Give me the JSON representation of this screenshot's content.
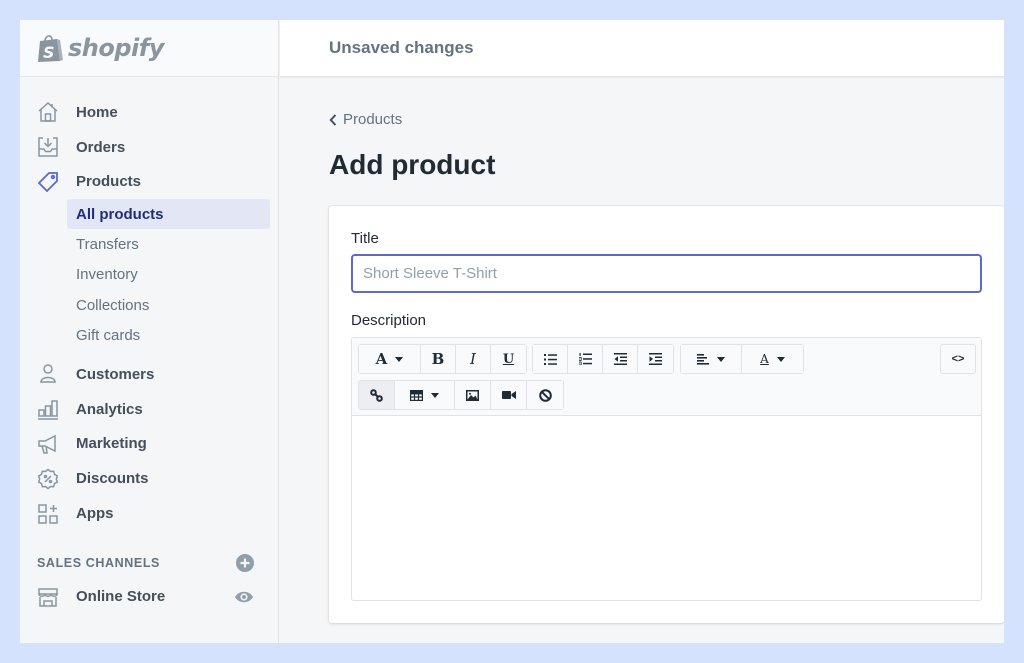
{
  "app": {
    "brand": "shopify"
  },
  "topbar": {
    "title": "Unsaved changes"
  },
  "sidebar": {
    "items": [
      {
        "label": "Home",
        "icon": "home-icon"
      },
      {
        "label": "Orders",
        "icon": "orders-icon"
      },
      {
        "label": "Products",
        "icon": "tag-icon",
        "active": true
      }
    ],
    "products_sub": [
      {
        "label": "All products",
        "active": true
      },
      {
        "label": "Transfers"
      },
      {
        "label": "Inventory"
      },
      {
        "label": "Collections"
      },
      {
        "label": "Gift cards"
      }
    ],
    "items_after": [
      {
        "label": "Customers",
        "icon": "customer-icon"
      },
      {
        "label": "Analytics",
        "icon": "analytics-icon"
      },
      {
        "label": "Marketing",
        "icon": "megaphone-icon"
      },
      {
        "label": "Discounts",
        "icon": "discount-icon"
      },
      {
        "label": "Apps",
        "icon": "apps-icon"
      }
    ],
    "sales_channels": {
      "heading": "SALES CHANNELS",
      "add_icon": "plus-circle-icon",
      "items": [
        {
          "label": "Online Store",
          "icon": "store-icon",
          "action_icon": "eye-icon"
        }
      ]
    }
  },
  "main": {
    "breadcrumb": "Products",
    "page_title": "Add product",
    "form": {
      "title_label": "Title",
      "title_value": "",
      "title_placeholder": "Short Sleeve T-Shirt",
      "description_label": "Description",
      "description_value": ""
    },
    "toolbar": {
      "row1": [
        {
          "name": "font-style",
          "glyph": "A",
          "dropdown": true
        },
        {
          "name": "bold",
          "glyph": "B"
        },
        {
          "name": "italic",
          "glyph": "I"
        },
        {
          "name": "underline",
          "glyph": "U"
        },
        {
          "name": "bullet-list"
        },
        {
          "name": "numbered-list"
        },
        {
          "name": "outdent"
        },
        {
          "name": "indent"
        },
        {
          "name": "align",
          "dropdown": true
        },
        {
          "name": "text-color",
          "glyph": "A",
          "dropdown": true
        }
      ],
      "row2": [
        {
          "name": "link",
          "active": true
        },
        {
          "name": "table",
          "dropdown": true
        },
        {
          "name": "image"
        },
        {
          "name": "video"
        },
        {
          "name": "clear-formatting"
        }
      ],
      "code_label": "<>"
    }
  },
  "colors": {
    "accent": "#5c6ac4",
    "active_nav_text": "#202e78",
    "active_nav_bg": "#e3e7f5",
    "page_bg": "#f4f6f8",
    "outer_bg": "#d5e2fd"
  }
}
